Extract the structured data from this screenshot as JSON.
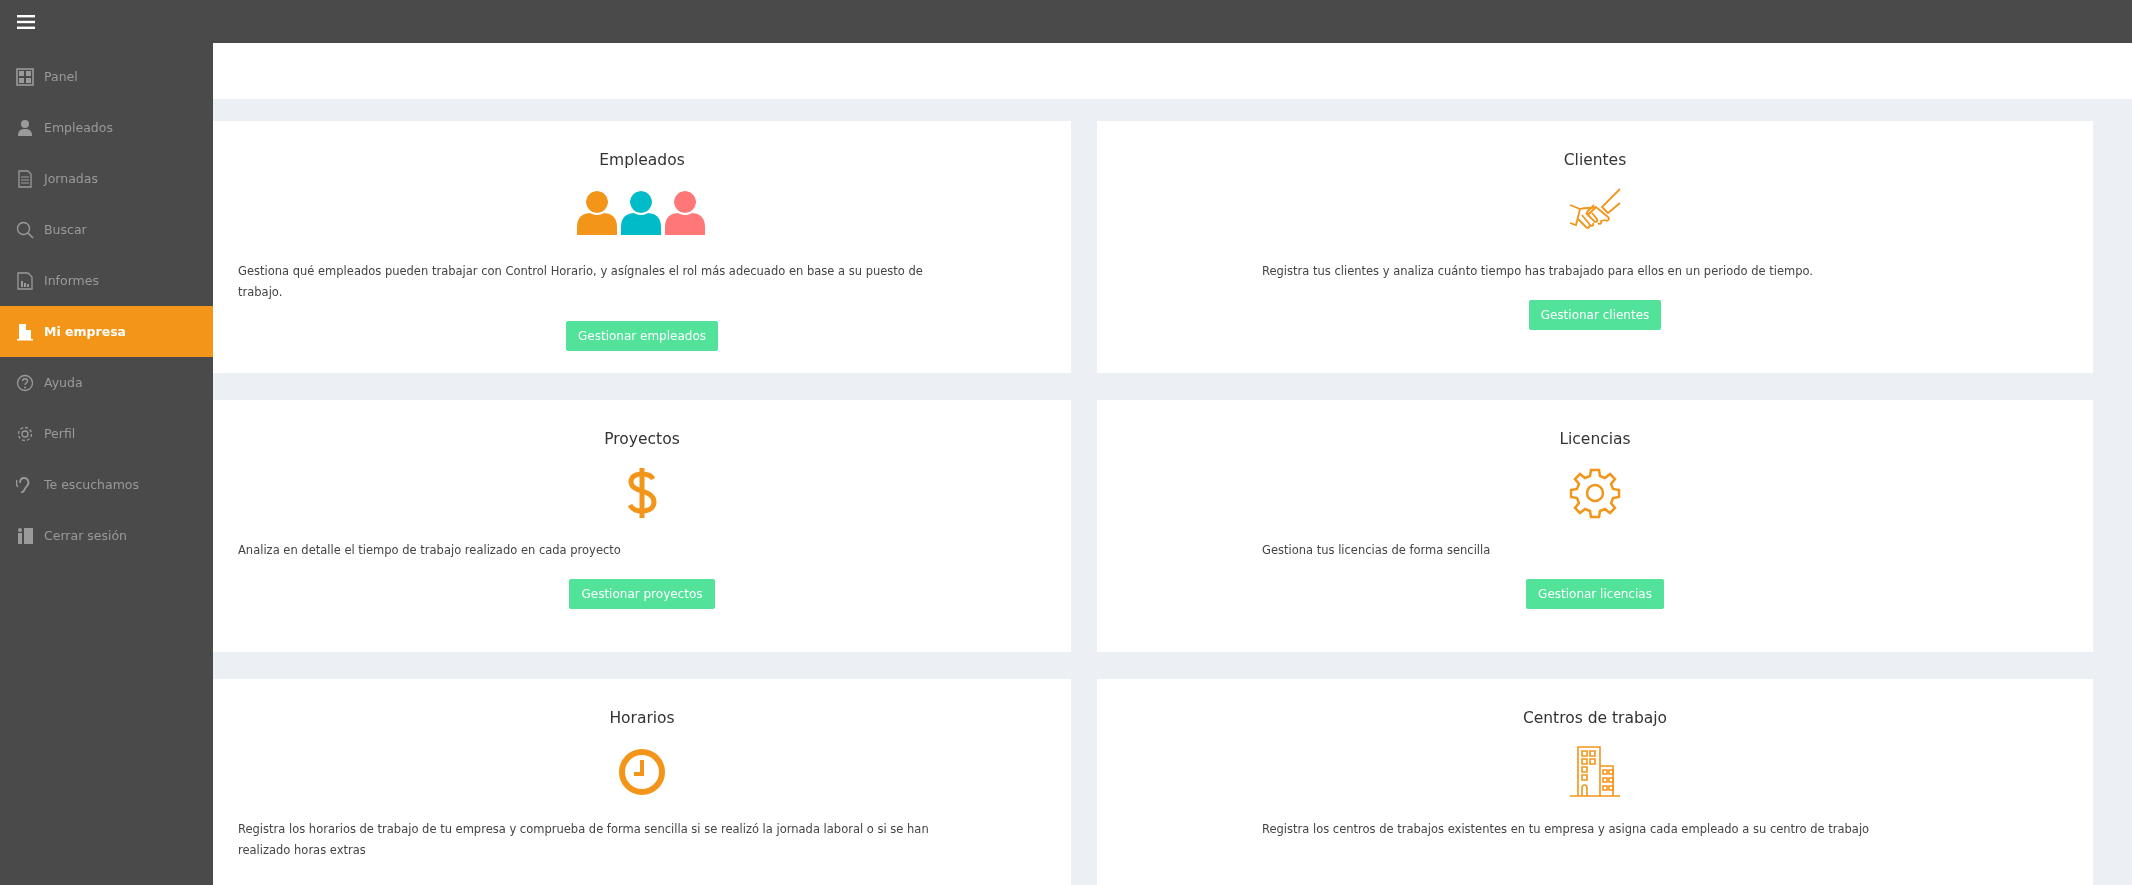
{
  "sidebar": {
    "items": [
      {
        "label": "Panel",
        "selected": false
      },
      {
        "label": "Empleados",
        "selected": false
      },
      {
        "label": "Jornadas",
        "selected": false
      },
      {
        "label": "Buscar",
        "selected": false
      },
      {
        "label": "Informes",
        "selected": false
      },
      {
        "label": "Mi empresa",
        "selected": true
      },
      {
        "label": "Ayuda",
        "selected": false
      },
      {
        "label": "Perfil",
        "selected": false
      },
      {
        "label": "Te escuchamos",
        "selected": false
      },
      {
        "label": "Cerrar sesión",
        "selected": false
      }
    ]
  },
  "cards": [
    {
      "title": "Empleados",
      "description": "Gestiona qué empleados pueden trabajar con Control Horario, y asígnales el rol más adecuado en base a su puesto de trabajo.",
      "button": "Gestionar empleados"
    },
    {
      "title": "Clientes",
      "description": "Registra tus clientes y analiza cuánto tiempo has trabajado para ellos en un periodo de tiempo.",
      "button": "Gestionar clientes"
    },
    {
      "title": "Proyectos",
      "description": "Analiza en detalle el tiempo de trabajo realizado en cada proyecto",
      "button": "Gestionar proyectos"
    },
    {
      "title": "Licencias",
      "description": "Gestiona tus licencias de forma sencilla",
      "button": "Gestionar licencias"
    },
    {
      "title": "Horarios",
      "description": "Registra los horarios de trabajo de tu empresa y comprueba de forma sencilla si se realizó la jornada laboral o si se han realizado horas extras"
    },
    {
      "title": "Centros de trabajo",
      "description": "Registra los centros de trabajos existentes en tu empresa y asigna cada empleado a su centro de trabajo"
    }
  ]
}
